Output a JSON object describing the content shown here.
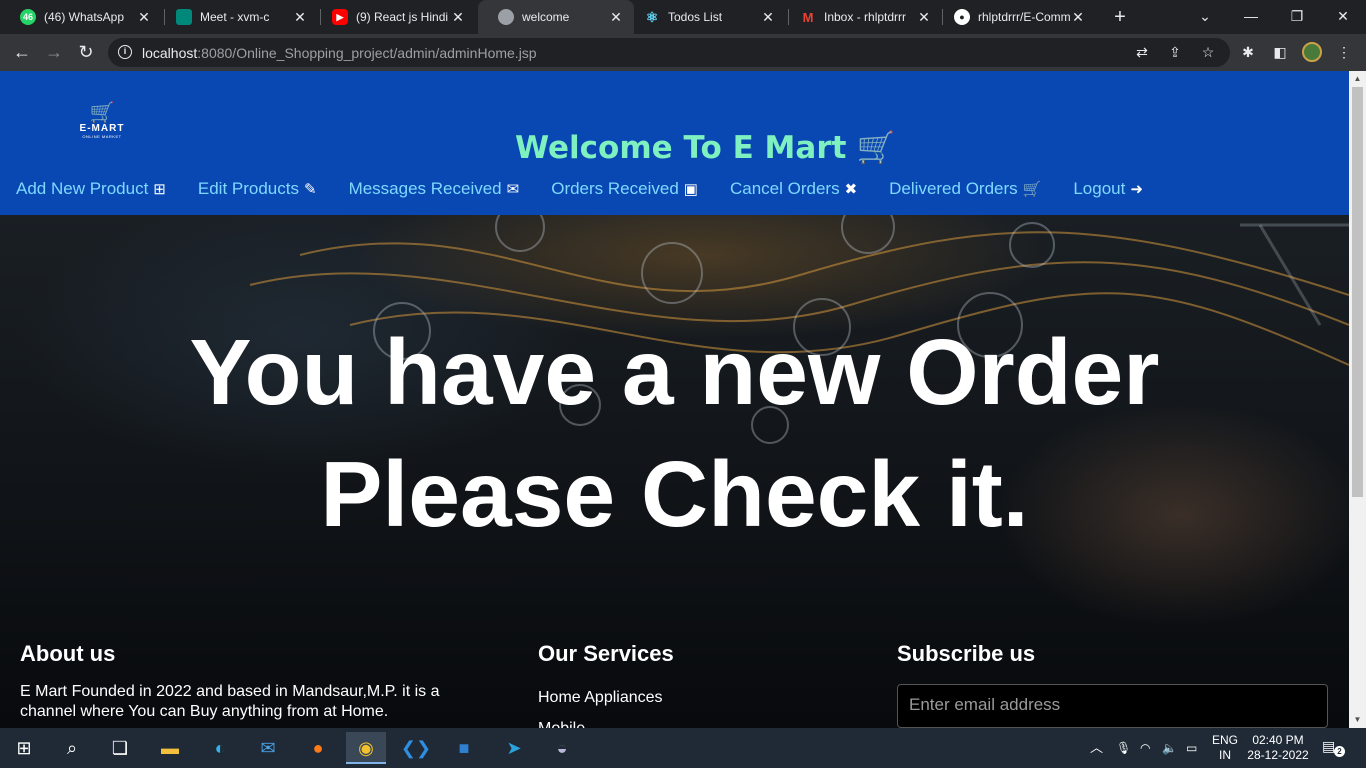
{
  "browser": {
    "tabs": [
      {
        "title": "(46) WhatsApp",
        "badge": "46",
        "favicon_color": "#25d366",
        "active": false
      },
      {
        "title": "Meet - xvm-c",
        "favicon_color": "#00897b",
        "active": false
      },
      {
        "title": "(9) React js Hindi",
        "favicon_color": "#ff0000",
        "active": false
      },
      {
        "title": "welcome",
        "favicon_color": "#9aa0a6",
        "active": true
      },
      {
        "title": "Todos List",
        "favicon_color": "#61dafb",
        "active": false
      },
      {
        "title": "Inbox - rhlptdrrr",
        "favicon_color": "#ea4335",
        "active": false
      },
      {
        "title": "rhlptdrrr/E-Comm",
        "favicon_color": "#ffffff",
        "active": false
      }
    ],
    "url_host": "localhost",
    "url_rest": ":8080/Online_Shopping_project/admin/adminHome.jsp"
  },
  "header": {
    "logo_name": "E-MART",
    "logo_sub": "ONLINE MARKET",
    "welcome_title": "Welcome To E Mart",
    "nav": [
      {
        "label": "Add New Product",
        "icon": "plus-square-icon",
        "glyph": "⊞"
      },
      {
        "label": "Edit Products",
        "icon": "edit-icon",
        "glyph": "✎"
      },
      {
        "label": "Messages Received",
        "icon": "envelope-icon",
        "glyph": "✉"
      },
      {
        "label": "Orders Received",
        "icon": "archive-icon",
        "glyph": "▣"
      },
      {
        "label": "Cancel Orders",
        "icon": "times-icon",
        "glyph": "✖"
      },
      {
        "label": "Delivered Orders",
        "icon": "cart-icon",
        "glyph": "🛒"
      },
      {
        "label": "Logout",
        "icon": "sign-out-icon",
        "glyph": "➜"
      }
    ]
  },
  "hero": {
    "line1": "You have a new Order",
    "line2": "Please Check it."
  },
  "footer": {
    "about_title": "About us",
    "about_text": "E Mart Founded in 2022 and based in Mandsaur,M.P. it is a channel where You can Buy anything from at Home.",
    "services_title": "Our Services",
    "services": [
      "Home Appliances",
      "Mobile"
    ],
    "subscribe_title": "Subscribe us",
    "email_placeholder": "Enter email address"
  },
  "taskbar": {
    "lang_top": "ENG",
    "lang_bottom": "IN",
    "time": "02:40 PM",
    "date": "28-12-2022",
    "notifications": "2"
  },
  "colors": {
    "header_bg": "#0948b3",
    "welcome_text": "#7ff0c0",
    "nav_text": "#7fd9ff"
  }
}
